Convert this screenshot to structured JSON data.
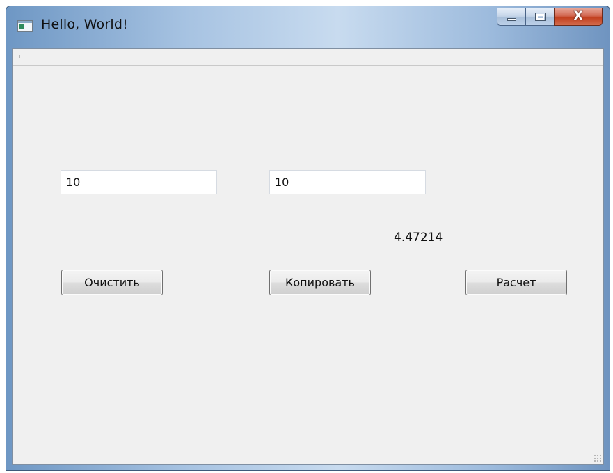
{
  "window": {
    "title": "Hello, World!",
    "caption_buttons": {
      "minimize_icon": "minimize-icon",
      "maximize_icon": "maximize-icon",
      "close_icon": "close-icon",
      "close_glyph": "X"
    }
  },
  "form": {
    "input1": {
      "value": "10"
    },
    "input2": {
      "value": "10"
    },
    "result_text": "4.47214",
    "buttons": {
      "clear_label": "Очистить",
      "copy_label": "Копировать",
      "calc_label": "Расчет"
    }
  },
  "colors": {
    "titlebar": "#a7c3e2",
    "client_bg": "#f0f0f0",
    "close_button": "#c2401f"
  }
}
